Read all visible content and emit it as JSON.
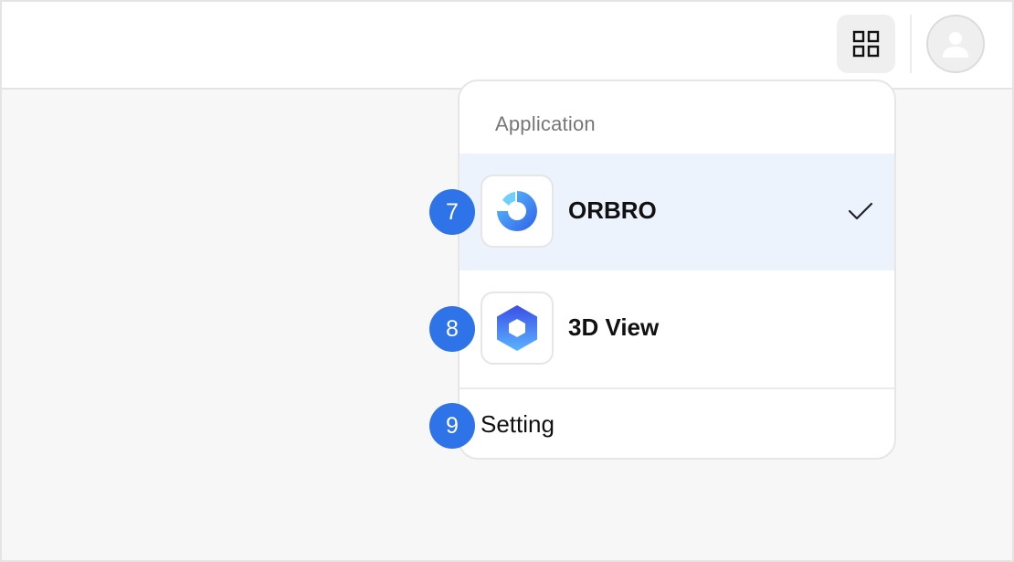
{
  "topbar": {
    "apps_icon": "grid-icon",
    "avatar_icon": "user-icon"
  },
  "menu": {
    "header": "Application",
    "items": [
      {
        "label": "ORBRO",
        "icon": "orbro-logo-icon",
        "selected": true
      },
      {
        "label": "3D View",
        "icon": "hexagon-3d-icon",
        "selected": false
      }
    ],
    "setting_label": "Setting"
  },
  "annotations": [
    "7",
    "8",
    "9"
  ],
  "colors": {
    "accent": "#2f73e8",
    "selected_bg": "#edf3fc"
  }
}
